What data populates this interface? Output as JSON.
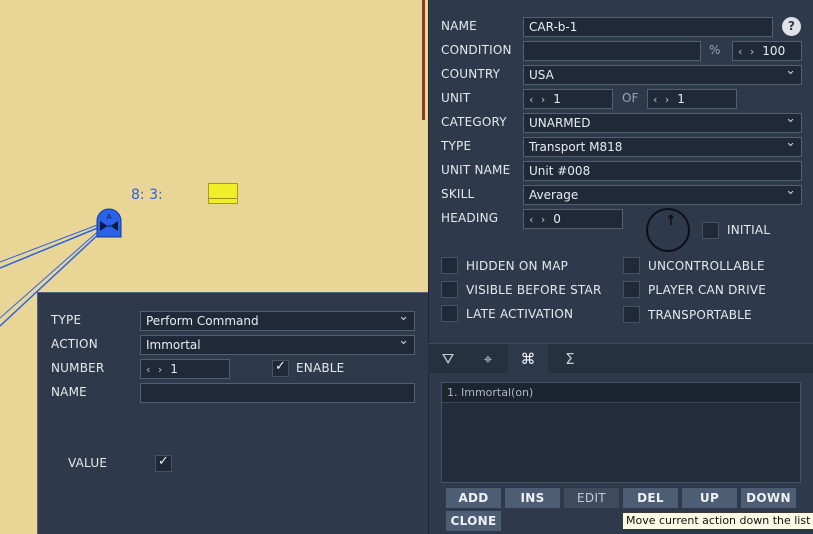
{
  "map": {
    "unit_label": "8: 3:",
    "unit_badge": "A"
  },
  "command_panel": {
    "type_label": "TYPE",
    "type_value": "Perform Command",
    "action_label": "ACTION",
    "action_value": "Immortal",
    "number_label": "NUMBER",
    "number_value": "1",
    "enable_label": "ENABLE",
    "name_label": "NAME",
    "name_value": "",
    "value_label": "VALUE"
  },
  "unit_props": {
    "name_label": "NAME",
    "name_value": "CAR-b-1",
    "help_label": "?",
    "condition_label": "CONDITION",
    "condition_value": "",
    "percent_sign": "%",
    "condition_pct": "100",
    "country_label": "COUNTRY",
    "country_value": "USA",
    "unit_label": "UNIT",
    "unit_value": "1",
    "of_label": "OF",
    "of_value": "1",
    "category_label": "CATEGORY",
    "category_value": "UNARMED",
    "type_label": "TYPE",
    "type_value": "Transport M818",
    "unit_name_label": "UNIT NAME",
    "unit_name_value": "Unit #008",
    "skill_label": "SKILL",
    "skill_value": "Average",
    "heading_label": "HEADING",
    "heading_value": "0",
    "initial_label": "INITIAL",
    "hidden_on_map": "HIDDEN ON MAP",
    "visible_before_start": "VISIBLE BEFORE STAR",
    "late_activation": "LATE ACTIVATION",
    "uncontrollable": "UNCONTROLLABLE",
    "player_can_drive": "PLAYER CAN DRIVE",
    "transportable": "TRANSPORTABLE"
  },
  "tabs": {
    "route": "⛛",
    "targeting": "⌖",
    "commands": "⌘",
    "summary": "Σ"
  },
  "actions": {
    "items": [
      "1. Immortal(on)"
    ]
  },
  "buttons": {
    "add": "ADD",
    "ins": "INS",
    "edit": "EDIT",
    "del": "DEL",
    "up": "UP",
    "down": "DOWN",
    "clone": "CLONE"
  },
  "tooltip": "Move current action down the list",
  "colors": {
    "panel_bg": "#2e3a4b",
    "map_bg": "#e9d595",
    "unit_blue": "#2a62e8",
    "marker_yellow": "#f1ee28"
  }
}
